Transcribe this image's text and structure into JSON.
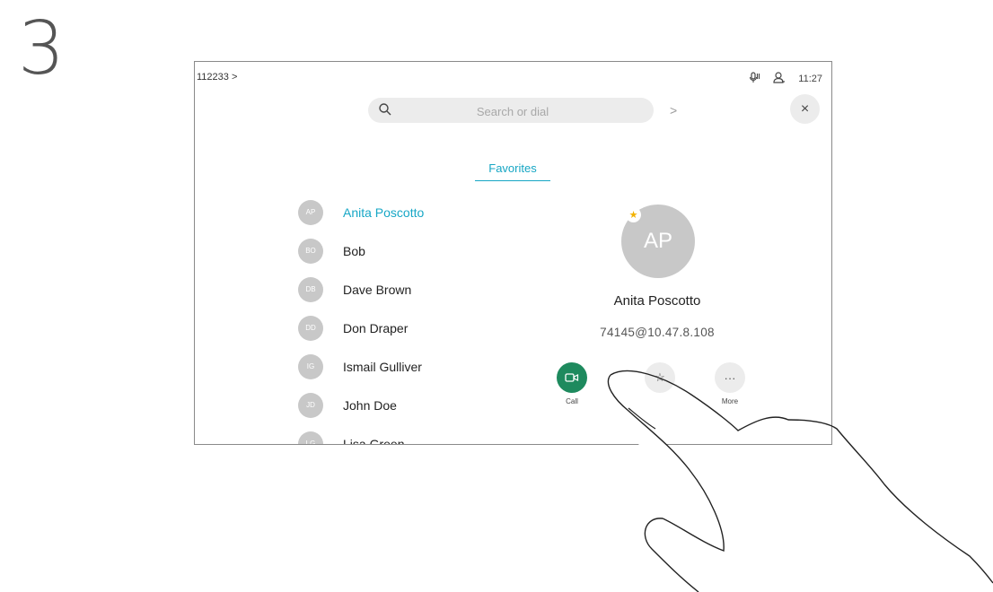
{
  "step_number": "3",
  "topbar": {
    "breadcrumb": "112233 >",
    "time": "11:27",
    "icons": [
      "microphone-icon",
      "person-icon"
    ]
  },
  "search": {
    "placeholder": "Search or dial",
    "dial_arrow": ">"
  },
  "close_label": "×",
  "tab": {
    "label": "Favorites"
  },
  "contacts": [
    {
      "initials": "AP",
      "name": "Anita Poscotto"
    },
    {
      "initials": "BO",
      "name": "Bob"
    },
    {
      "initials": "DB",
      "name": "Dave Brown"
    },
    {
      "initials": "DD",
      "name": "Don Draper"
    },
    {
      "initials": "IG",
      "name": "Ismail Gulliver"
    },
    {
      "initials": "JD",
      "name": "John Doe"
    },
    {
      "initials": "LG",
      "name": "Lisa Green"
    }
  ],
  "detail": {
    "initials": "AP",
    "name": "Anita Poscotto",
    "address": "74145@10.47.8.108"
  },
  "actions": {
    "call_label": "Call",
    "more_label": "More",
    "more_glyph": "···"
  },
  "colors": {
    "accent": "#17a7c6",
    "call_green": "#1e8a5e",
    "avatar_grey": "#c8c8c8",
    "favorite_star": "#f2b200"
  }
}
